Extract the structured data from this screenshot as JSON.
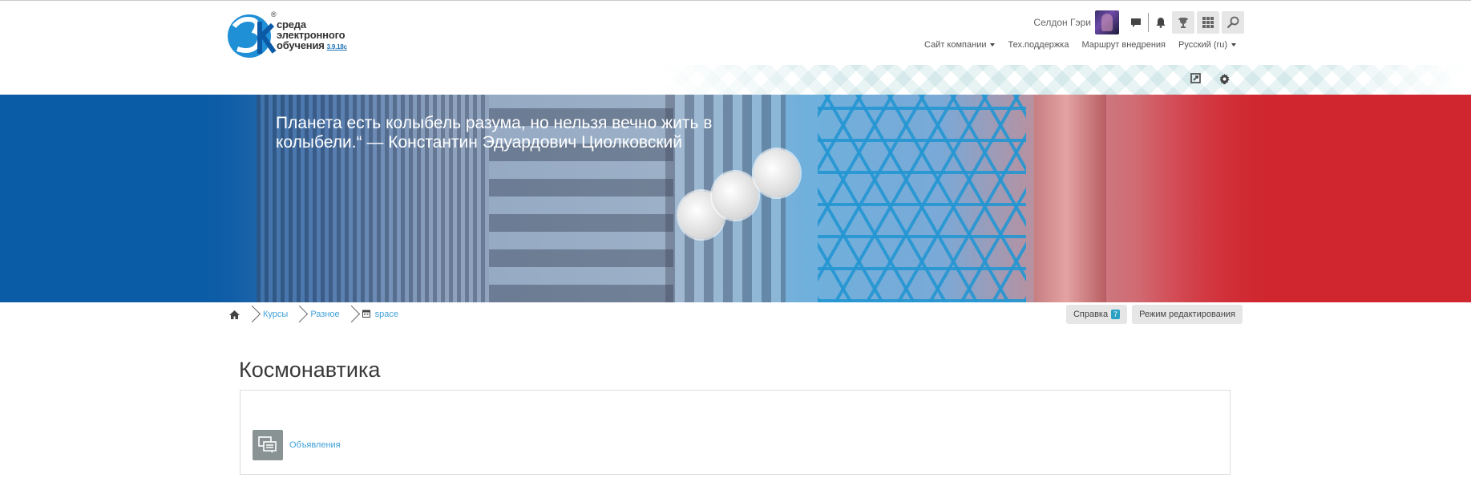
{
  "logo": {
    "line1": "среда",
    "line2": "электронного",
    "line3": "обучения",
    "version": "3.9.18с",
    "reg": "®",
    "mark": "3k"
  },
  "user": {
    "name": "Селдон Гэри"
  },
  "nav": {
    "items": [
      {
        "label": "Сайт компании",
        "dropdown": true
      },
      {
        "label": "Тех.поддержка",
        "dropdown": false
      },
      {
        "label": "Маршрут внедрения",
        "dropdown": false
      },
      {
        "label": "Русский (ru)",
        "dropdown": true
      }
    ]
  },
  "banner": {
    "quote": "Планета есть колыбель разума, но нельзя вечно жить в колыбели.“ — Константин Эдуардович Циолковский"
  },
  "breadcrumb": {
    "items": [
      "Курсы",
      "Разное",
      "space"
    ]
  },
  "actions": {
    "help_label": "Справка",
    "help_badge": "7",
    "edit_mode_label": "Режим редактирования"
  },
  "page": {
    "title": "Космонавтика"
  },
  "course": {
    "activity_label": "Объявления"
  },
  "colors": {
    "link": "#3fa0d8",
    "banner_left": "#0b5ca6",
    "banner_right": "#d0262f",
    "badge": "#2aa0c4"
  }
}
